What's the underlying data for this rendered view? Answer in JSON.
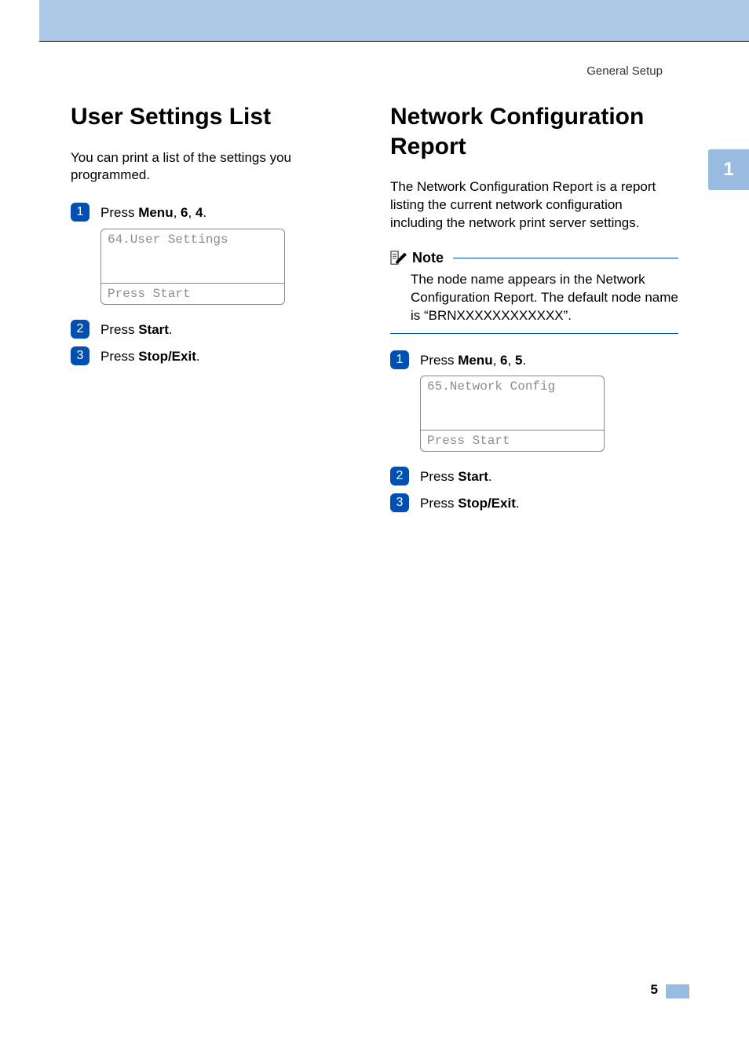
{
  "header": {
    "section": "General Setup"
  },
  "chapter_tab": "1",
  "page_number": "5",
  "left": {
    "title": "User Settings List",
    "intro": "You can print a list of the settings you programmed.",
    "step1": {
      "prefix": "Press ",
      "b1": "Menu",
      "mid1": ", ",
      "b2": "6",
      "mid2": ", ",
      "b3": "4",
      "suffix": "."
    },
    "lcd": {
      "line1": "64.User Settings",
      "line2": "Press Start"
    },
    "step2": {
      "prefix": "Press ",
      "b1": "Start",
      "suffix": "."
    },
    "step3": {
      "prefix": "Press ",
      "b1": "Stop/Exit",
      "suffix": "."
    }
  },
  "right": {
    "title": "Network Configuration Report",
    "intro": "The Network Configuration Report is a report listing the current network configuration including the network print server settings.",
    "note": {
      "label": "Note",
      "body": "The node name appears in the Network Configuration Report. The default node name is “BRNXXXXXXXXXXXX”."
    },
    "step1": {
      "prefix": "Press ",
      "b1": "Menu",
      "mid1": ", ",
      "b2": "6",
      "mid2": ", ",
      "b3": "5",
      "suffix": "."
    },
    "lcd": {
      "line1": "65.Network Config",
      "line2": "Press Start"
    },
    "step2": {
      "prefix": "Press ",
      "b1": "Start",
      "suffix": "."
    },
    "step3": {
      "prefix": "Press ",
      "b1": "Stop/Exit",
      "suffix": "."
    }
  }
}
